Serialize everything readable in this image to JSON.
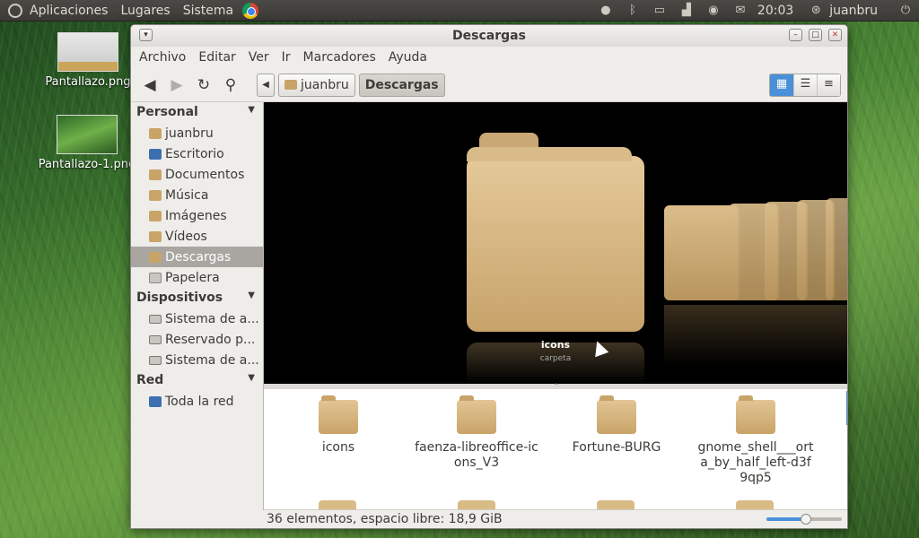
{
  "panel": {
    "menus": [
      "Aplicaciones",
      "Lugares",
      "Sistema"
    ],
    "clock": "20:03",
    "user": "juanbru"
  },
  "desktop": {
    "icons": [
      {
        "label": "Pantallazo.png"
      },
      {
        "label": "Pantallazo-1.png"
      }
    ]
  },
  "window": {
    "title": "Descargas",
    "menu": [
      "Archivo",
      "Editar",
      "Ver",
      "Ir",
      "Marcadores",
      "Ayuda"
    ],
    "path": [
      "juanbru",
      "Descargas"
    ]
  },
  "sidebar": {
    "sections": [
      {
        "title": "Personal",
        "items": [
          "juanbru",
          "Escritorio",
          "Documentos",
          "Música",
          "Imágenes",
          "Vídeos",
          "Descargas",
          "Papelera"
        ]
      },
      {
        "title": "Dispositivos",
        "items": [
          "Sistema de a...",
          "Reservado p...",
          "Sistema de a..."
        ]
      },
      {
        "title": "Red",
        "items": [
          "Toda la red"
        ]
      }
    ]
  },
  "preview": {
    "title": "icons",
    "subtitle": "carpeta"
  },
  "files": [
    {
      "label": "icons"
    },
    {
      "label": "faenza-libreoffice-icons_V3"
    },
    {
      "label": "Fortune-BURG"
    },
    {
      "label": "gnome_shell___orta_by_half_left-d3f9qp5"
    }
  ],
  "status": {
    "text": "36 elementos, espacio libre: 18,9 GiB",
    "zoom_level": 0.5
  }
}
